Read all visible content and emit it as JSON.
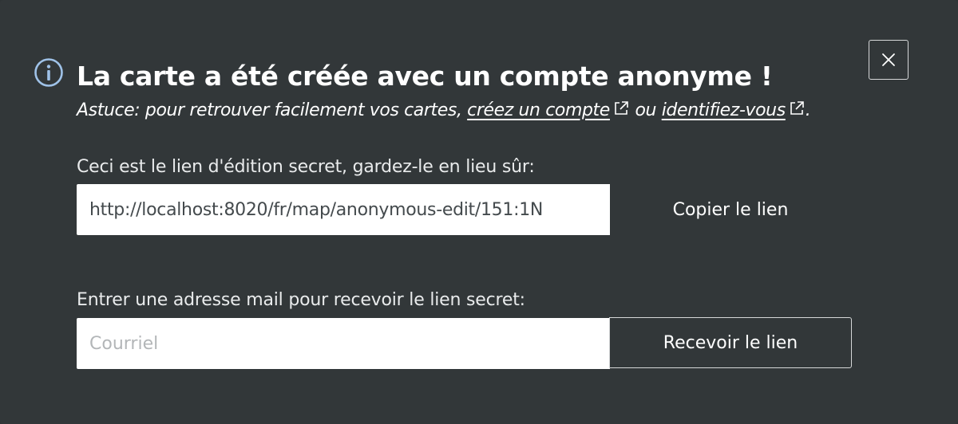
{
  "dialog": {
    "close_icon": "close-icon",
    "info_icon": "info-circle-icon",
    "title": "La carte a été créée avec un compte anonyme !",
    "tip": {
      "prefix": "Astuce: pour retrouver facilement vos cartes, ",
      "create_account_link": "créez un compte",
      "middle": " ou ",
      "login_link": "identifiez-vous",
      "suffix": ".",
      "link_icon": "external-link-icon"
    },
    "secret_link": {
      "label": "Ceci est le lien d'édition secret, gardez-le en lieu sûr:",
      "value": "http://localhost:8020/fr/map/anonymous-edit/151:1N",
      "copy_label": "Copier le lien"
    },
    "email": {
      "label": "Entrer une adresse mail pour recevoir le lien secret:",
      "placeholder": "Courriel",
      "value": "",
      "submit_label": "Recevoir le lien"
    }
  },
  "colors": {
    "background": "#323739",
    "text": "#ffffff",
    "info_icon": "#9fc2e8"
  }
}
